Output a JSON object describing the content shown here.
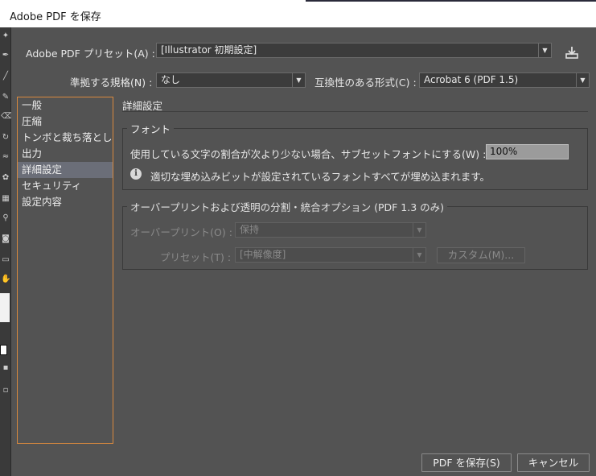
{
  "window": {
    "title": "Adobe PDF を保存"
  },
  "preset": {
    "label": "Adobe PDF プリセット(A) :",
    "value": "[Illustrator 初期設定]"
  },
  "standard": {
    "label": "準拠する規格(N) :",
    "value": "なし"
  },
  "compatibility": {
    "label": "互換性のある形式(C) :",
    "value": "Acrobat 6 (PDF 1.5)"
  },
  "sidebar": {
    "items": [
      {
        "label": "一般"
      },
      {
        "label": "圧縮"
      },
      {
        "label": "トンボと裁ち落とし"
      },
      {
        "label": "出力"
      },
      {
        "label": "詳細設定"
      },
      {
        "label": "セキュリティ"
      },
      {
        "label": "設定内容"
      }
    ],
    "selected_index": 4
  },
  "main": {
    "section_title": "詳細設定",
    "fonts": {
      "legend": "フォント",
      "subset_label": "使用している文字の割合が次より少ない場合、サブセットフォントにする(W) :",
      "subset_value": "100%",
      "info_text": "適切な埋め込みビットが設定されているフォントすべてが埋め込まれます。"
    },
    "overprint": {
      "legend": "オーバープリントおよび透明の分割・統合オプション (PDF 1.3 のみ)",
      "overprint_label": "オーバープリント(O) :",
      "overprint_value": "保持",
      "preset_label": "プリセット(T) :",
      "preset_value": "[中解像度]",
      "custom_label": "カスタム(M)..."
    }
  },
  "buttons": {
    "save": "PDF を保存(S)",
    "cancel": "キャンセル"
  },
  "icons": {
    "dropdown_arrow": "▼",
    "info": "i",
    "save_preset": "save-preset-icon"
  },
  "colors": {
    "dialog_bg": "#535353",
    "field_bg": "#3c3c3c",
    "selection": "#6b6e78",
    "focus_border": "#d9893e"
  }
}
